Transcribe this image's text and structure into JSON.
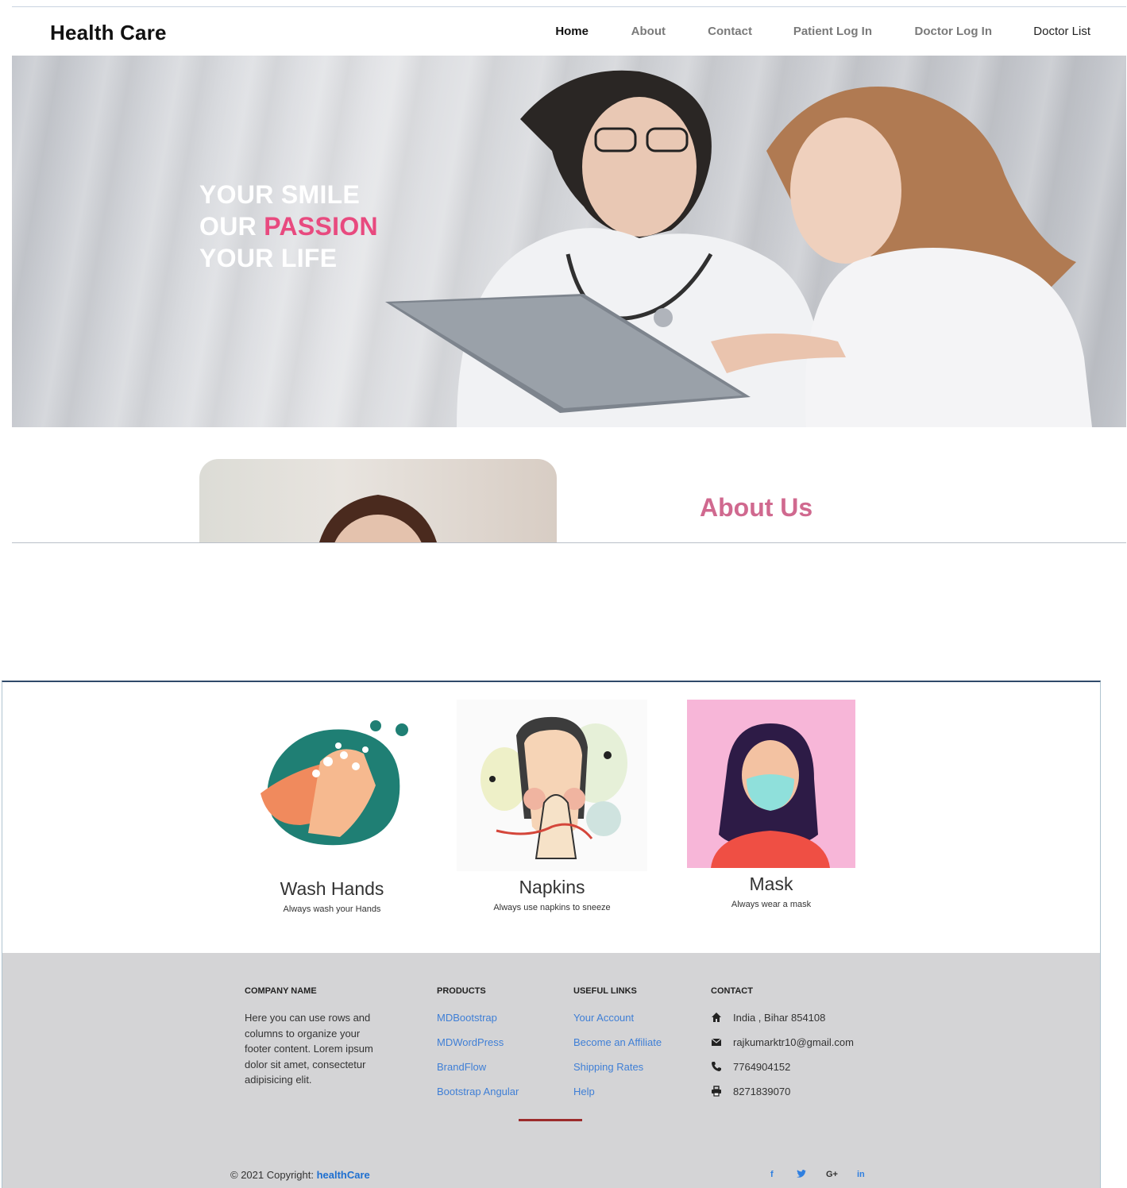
{
  "navbar": {
    "brand": "Health Care",
    "links": [
      {
        "label": "Home"
      },
      {
        "label": "About"
      },
      {
        "label": "Contact"
      },
      {
        "label": "Patient Log In"
      },
      {
        "label": "Doctor Log In"
      },
      {
        "label": "Doctor List"
      }
    ]
  },
  "hero": {
    "line1": "YOUR SMILE",
    "line2_prefix": "OUR ",
    "line2_accent": "PASSION",
    "line3": "YOUR LIFE",
    "accent_color": "#e84a7f"
  },
  "about": {
    "heading": "About Us",
    "heading_color": "#d0698f"
  },
  "cards": [
    {
      "title": "Wash Hands",
      "subtitle": "Always wash your Hands",
      "icon": "wash-hands-illustration"
    },
    {
      "title": "Napkins",
      "subtitle": "Always use napkins to sneeze",
      "icon": "sneeze-illustration"
    },
    {
      "title": "Mask",
      "subtitle": "Always wear a mask",
      "icon": "mask-illustration"
    }
  ],
  "footer": {
    "company": {
      "heading": "COMPANY NAME",
      "text": "Here you can use rows and columns to organize your footer content. Lorem ipsum dolor sit amet, consectetur adipisicing elit."
    },
    "products": {
      "heading": "PRODUCTS",
      "links": [
        "MDBootstrap",
        "MDWordPress",
        "BrandFlow",
        "Bootstrap Angular"
      ]
    },
    "useful": {
      "heading": "USEFUL LINKS",
      "links": [
        "Your Account",
        "Become an Affiliate",
        "Shipping Rates",
        "Help"
      ]
    },
    "contact": {
      "heading": "CONTACT",
      "items": [
        {
          "icon": "home-icon",
          "text": "India , Bihar 854108"
        },
        {
          "icon": "envelope-icon",
          "text": "rajkumarktr10@gmail.com"
        },
        {
          "icon": "phone-icon",
          "text": "7764904152"
        },
        {
          "icon": "printer-icon",
          "text": "8271839070"
        }
      ]
    },
    "copyright_prefix": "© 2021 Copyright: ",
    "copyright_brand": "healthCare",
    "social": [
      "f",
      "♥",
      "G+",
      "in"
    ],
    "link_color": "#3f7fd6",
    "background": "#d4d4d6"
  }
}
